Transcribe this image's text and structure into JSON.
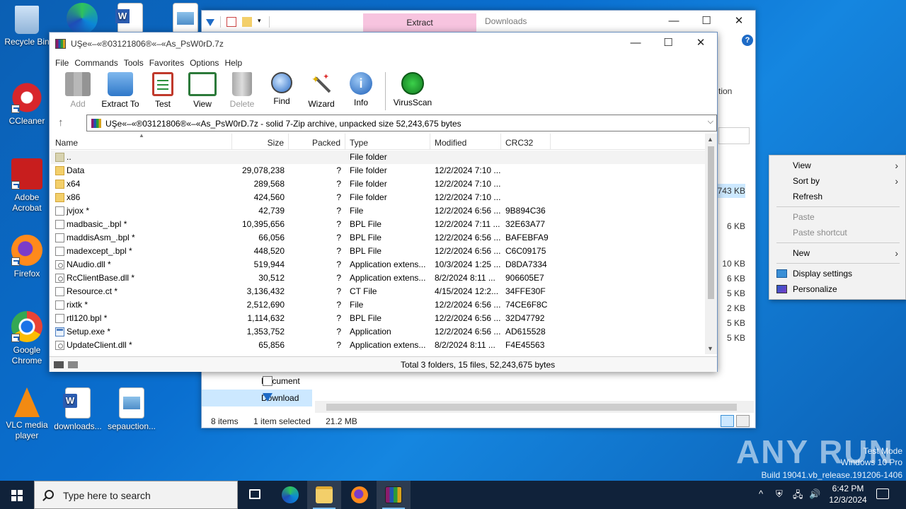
{
  "desktop": {
    "icons": [
      {
        "label": "Recycle Bin"
      },
      {
        "label": "CCleaner"
      },
      {
        "label": "Adobe Acrobat"
      },
      {
        "label": "Firefox"
      },
      {
        "label": "Google Chrome"
      },
      {
        "label": "VLC media player"
      },
      {
        "label": "downloads..."
      },
      {
        "label": "sepauction..."
      }
    ]
  },
  "explorer": {
    "ribbon_tab_extract": "Extract",
    "title": "Downloads",
    "ribbon_partial_text": "tion",
    "sizes": [
      "743 KB",
      "6 KB",
      "10 KB",
      "6 KB",
      "5 KB",
      "2 KB",
      "5 KB",
      "5 KB"
    ],
    "nav": [
      "Document",
      "Download"
    ],
    "status": {
      "items": "8 items",
      "selected": "1 item selected",
      "size": "21.2 MB"
    }
  },
  "winrar": {
    "title": "UŞe«–«®03121806®«–«As_PsW0rD.7z",
    "menu": [
      "File",
      "Commands",
      "Tools",
      "Favorites",
      "Options",
      "Help"
    ],
    "toolbar": [
      "Add",
      "Extract To",
      "Test",
      "View",
      "Delete",
      "Find",
      "Wizard",
      "Info",
      "VirusScan"
    ],
    "path": "UŞe«–«®03121806®«–«As_PsW0rD.7z - solid 7-Zip archive, unpacked size 52,243,675 bytes",
    "columns": [
      "Name",
      "Size",
      "Packed",
      "Type",
      "Modified",
      "CRC32"
    ],
    "rows": [
      {
        "name": "..",
        "size": "",
        "packed": "",
        "type": "File folder",
        "modified": "",
        "crc": "",
        "icon": "parent"
      },
      {
        "name": "Data",
        "size": "29,078,238",
        "packed": "?",
        "type": "File folder",
        "modified": "12/2/2024 7:10 ...",
        "crc": "",
        "icon": "folder"
      },
      {
        "name": "x64",
        "size": "289,568",
        "packed": "?",
        "type": "File folder",
        "modified": "12/2/2024 7:10 ...",
        "crc": "",
        "icon": "folder"
      },
      {
        "name": "x86",
        "size": "424,560",
        "packed": "?",
        "type": "File folder",
        "modified": "12/2/2024 7:10 ...",
        "crc": "",
        "icon": "folder"
      },
      {
        "name": "jvjox *",
        "size": "42,739",
        "packed": "?",
        "type": "File",
        "modified": "12/2/2024 6:56 ...",
        "crc": "9B894C36",
        "icon": "file"
      },
      {
        "name": "madbasic_.bpl *",
        "size": "10,395,656",
        "packed": "?",
        "type": "BPL File",
        "modified": "12/2/2024 7:11 ...",
        "crc": "32E63A77",
        "icon": "file"
      },
      {
        "name": "maddisAsm_.bpl *",
        "size": "66,056",
        "packed": "?",
        "type": "BPL File",
        "modified": "12/2/2024 6:56 ...",
        "crc": "BAFEBFA9",
        "icon": "file"
      },
      {
        "name": "madexcept_.bpl *",
        "size": "448,520",
        "packed": "?",
        "type": "BPL File",
        "modified": "12/2/2024 6:56 ...",
        "crc": "C6C09175",
        "icon": "file"
      },
      {
        "name": "NAudio.dll *",
        "size": "519,944",
        "packed": "?",
        "type": "Application extens...",
        "modified": "10/3/2024 1:25 ...",
        "crc": "D8DA7334",
        "icon": "dll"
      },
      {
        "name": "RcClientBase.dll *",
        "size": "30,512",
        "packed": "?",
        "type": "Application extens...",
        "modified": "8/2/2024 8:11 ...",
        "crc": "906605E7",
        "icon": "dll"
      },
      {
        "name": "Resource.ct *",
        "size": "3,136,432",
        "packed": "?",
        "type": "CT File",
        "modified": "4/15/2024 12:2...",
        "crc": "34FFE30F",
        "icon": "file"
      },
      {
        "name": "rixtk *",
        "size": "2,512,690",
        "packed": "?",
        "type": "File",
        "modified": "12/2/2024 6:56 ...",
        "crc": "74CE6F8C",
        "icon": "file"
      },
      {
        "name": "rtl120.bpl *",
        "size": "1,114,632",
        "packed": "?",
        "type": "BPL File",
        "modified": "12/2/2024 6:56 ...",
        "crc": "32D47792",
        "icon": "file"
      },
      {
        "name": "Setup.exe *",
        "size": "1,353,752",
        "packed": "?",
        "type": "Application",
        "modified": "12/2/2024 6:56 ...",
        "crc": "AD615528",
        "icon": "exe"
      },
      {
        "name": "UpdateClient.dll *",
        "size": "65,856",
        "packed": "?",
        "type": "Application extens...",
        "modified": "8/2/2024 8:11 ...",
        "crc": "F4E45563",
        "icon": "dll"
      }
    ],
    "status": "Total 3 folders, 15 files, 52,243,675 bytes"
  },
  "context_menu": {
    "view": "View",
    "sort_by": "Sort by",
    "refresh": "Refresh",
    "paste": "Paste",
    "paste_shortcut": "Paste shortcut",
    "new": "New",
    "display_settings": "Display settings",
    "personalize": "Personalize"
  },
  "watermark": {
    "mode": "Test Mode",
    "os": "Windows 10 Pro",
    "build": "Build 19041.vb_release.191206-1406",
    "brand": "ANY RUN"
  },
  "taskbar": {
    "search_placeholder": "Type here to search",
    "time": "6:42 PM",
    "date": "12/3/2024"
  }
}
